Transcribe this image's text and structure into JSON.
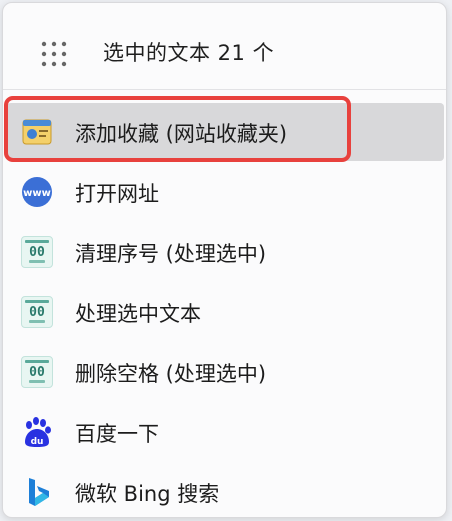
{
  "header": {
    "title": "选中的文本 21 个",
    "grip_icon": "drag-grip-icon"
  },
  "menu": {
    "items": [
      {
        "label": "添加收藏 (网站收藏夹)",
        "icon": "bookmark-icon",
        "highlighted": true
      },
      {
        "label": "打开网址",
        "icon": "www-icon"
      },
      {
        "label": "清理序号 (处理选中)",
        "icon": "script-icon"
      },
      {
        "label": "处理选中文本",
        "icon": "script-icon"
      },
      {
        "label": "删除空格 (处理选中)",
        "icon": "script-icon"
      },
      {
        "label": "百度一下",
        "icon": "baidu-icon"
      },
      {
        "label": "微软 Bing 搜索",
        "icon": "bing-icon"
      }
    ]
  },
  "colors": {
    "highlight": "#d8d8da",
    "focus_ring": "#e8413d",
    "www_blue": "#3b6fd6",
    "baidu_blue": "#2932e1",
    "bing_blue": "#1d7fd8"
  }
}
